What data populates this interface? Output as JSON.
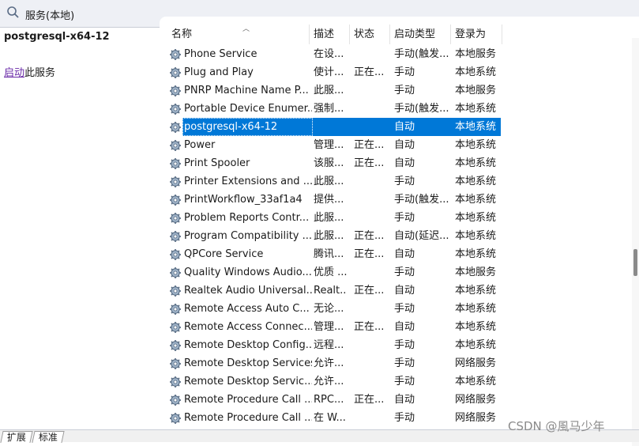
{
  "window": {
    "title": "服务(本地)"
  },
  "left_panel": {
    "service_name": "postgresql-x64-12",
    "start_link": "启动",
    "start_suffix": "此服务"
  },
  "columns": [
    "名称",
    "描述",
    "状态",
    "启动类型",
    "登录为"
  ],
  "rows": [
    {
      "name": "Phone Service",
      "desc": "在设...",
      "status": "",
      "startup": "手动(触发...",
      "logon": "本地服务"
    },
    {
      "name": "Plug and Play",
      "desc": "使计...",
      "status": "正在...",
      "startup": "手动",
      "logon": "本地系统"
    },
    {
      "name": "PNRP Machine Name P...",
      "desc": "此服...",
      "status": "",
      "startup": "手动",
      "logon": "本地服务"
    },
    {
      "name": "Portable Device Enumer...",
      "desc": "强制...",
      "status": "",
      "startup": "手动(触发...",
      "logon": "本地系统"
    },
    {
      "name": "postgresql-x64-12",
      "desc": "",
      "status": "",
      "startup": "自动",
      "logon": "本地系统",
      "selected": true
    },
    {
      "name": "Power",
      "desc": "管理...",
      "status": "正在...",
      "startup": "自动",
      "logon": "本地系统"
    },
    {
      "name": "Print Spooler",
      "desc": "该服...",
      "status": "正在...",
      "startup": "自动",
      "logon": "本地系统"
    },
    {
      "name": "Printer Extensions and ...",
      "desc": "此服...",
      "status": "",
      "startup": "手动",
      "logon": "本地系统"
    },
    {
      "name": "PrintWorkflow_33af1a4",
      "desc": "提供...",
      "status": "",
      "startup": "手动(触发...",
      "logon": "本地系统"
    },
    {
      "name": "Problem Reports Contr...",
      "desc": "此服...",
      "status": "",
      "startup": "手动",
      "logon": "本地系统"
    },
    {
      "name": "Program Compatibility ...",
      "desc": "此服...",
      "status": "正在...",
      "startup": "自动(延迟...",
      "logon": "本地系统"
    },
    {
      "name": "QPCore Service",
      "desc": "腾讯...",
      "status": "正在...",
      "startup": "自动",
      "logon": "本地系统"
    },
    {
      "name": "Quality Windows Audio...",
      "desc": "优质 ...",
      "status": "",
      "startup": "手动",
      "logon": "本地服务"
    },
    {
      "name": "Realtek Audio Universal...",
      "desc": "Realt...",
      "status": "正在...",
      "startup": "自动",
      "logon": "本地系统"
    },
    {
      "name": "Remote Access Auto C...",
      "desc": "无论...",
      "status": "",
      "startup": "手动",
      "logon": "本地系统"
    },
    {
      "name": "Remote Access Connec...",
      "desc": "管理...",
      "status": "正在...",
      "startup": "自动",
      "logon": "本地系统"
    },
    {
      "name": "Remote Desktop Config...",
      "desc": "远程...",
      "status": "",
      "startup": "手动",
      "logon": "本地系统"
    },
    {
      "name": "Remote Desktop Services",
      "desc": "允许...",
      "status": "",
      "startup": "手动",
      "logon": "网络服务"
    },
    {
      "name": "Remote Desktop Servic...",
      "desc": "允许...",
      "status": "",
      "startup": "手动",
      "logon": "本地系统"
    },
    {
      "name": "Remote Procedure Call ...",
      "desc": "RPC...",
      "status": "正在...",
      "startup": "自动",
      "logon": "网络服务"
    },
    {
      "name": "Remote Procedure Call ...",
      "desc": "在 W...",
      "status": "",
      "startup": "手动",
      "logon": "网络服务"
    }
  ],
  "bottom_tabs": [
    "扩展",
    "标准"
  ],
  "watermark": "CSDN @風马少年",
  "colors": {
    "selection": "#0078d7",
    "link": "#6a2aa8"
  }
}
